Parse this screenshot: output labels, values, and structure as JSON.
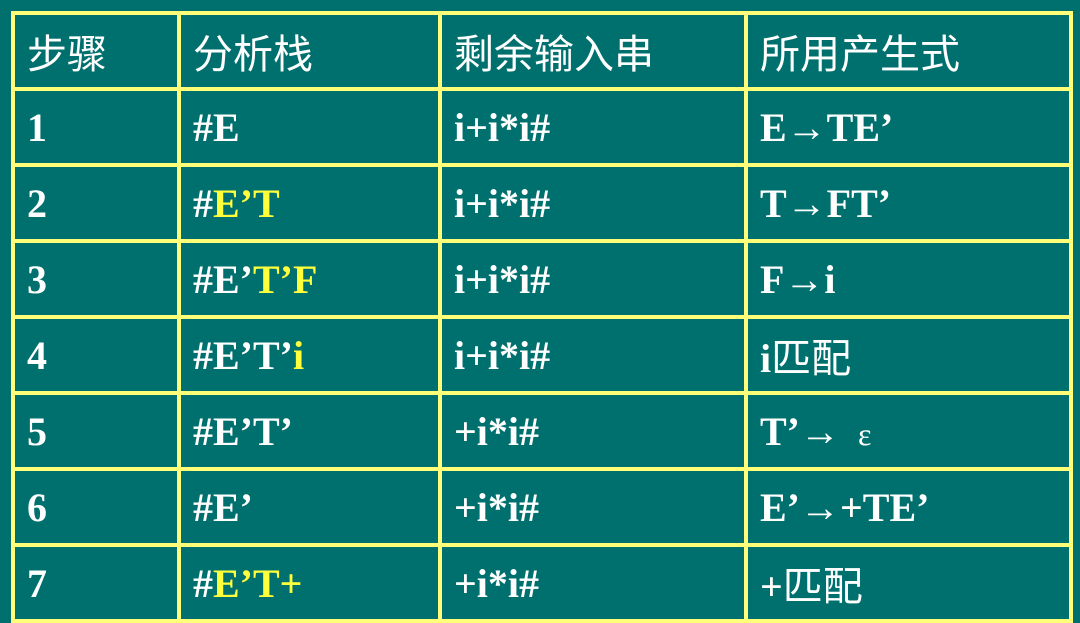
{
  "headers": [
    "步骤",
    "分析栈",
    "剩余输入串",
    "所用产生式"
  ],
  "colors": {
    "background": "#00706f",
    "border": "#ffff7a",
    "text": "#ffffff",
    "highlight": "#ffff3c"
  },
  "rows": [
    {
      "step": "1",
      "stack": {
        "plain": "#E",
        "highlight": ""
      },
      "input": "i+i*i#",
      "production": "E→TE’"
    },
    {
      "step": "2",
      "stack": {
        "plain": "#",
        "highlight": "E’T"
      },
      "input": "i+i*i#",
      "production": "T→FT’"
    },
    {
      "step": "3",
      "stack": {
        "plain": "#E’",
        "highlight": "T’F"
      },
      "input": "i+i*i#",
      "production": "F→i"
    },
    {
      "step": "4",
      "stack": {
        "plain": "#E’T’",
        "highlight": "i"
      },
      "input": "i+i*i#",
      "production": {
        "symbol": "i",
        "text": "匹配"
      }
    },
    {
      "step": "5",
      "stack": {
        "plain": "#E’T’",
        "highlight": ""
      },
      "input": "+i*i#",
      "production": {
        "lhs": "T’→",
        "epsilon": "ε"
      }
    },
    {
      "step": "6",
      "stack": {
        "plain": "#E’",
        "highlight": ""
      },
      "input": "+i*i#",
      "production": "E’→+TE’"
    },
    {
      "step": "7",
      "stack": {
        "plain": "#",
        "highlight": "E’T+"
      },
      "input": "+i*i#",
      "production": {
        "symbol": "+",
        "text": "匹配"
      }
    }
  ]
}
